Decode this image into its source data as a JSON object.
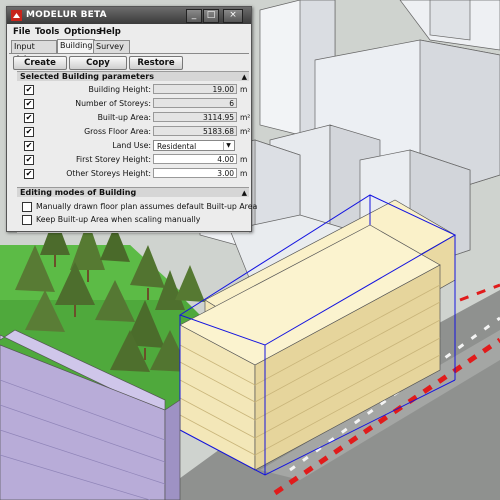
{
  "window": {
    "title": "MODELUR BETA",
    "controls": {
      "minimize": "_",
      "maximize": "□",
      "close": "×"
    }
  },
  "menu": [
    "File",
    "Tools",
    "Options",
    "Help"
  ],
  "tabs": [
    {
      "label": "Input data",
      "active": false
    },
    {
      "label": "Building",
      "active": true
    },
    {
      "label": "Survey",
      "active": false
    }
  ],
  "actions": {
    "create": "Create",
    "copy": "Copy",
    "restore": "Restore"
  },
  "sections": {
    "building_params": "Selected Building parameters",
    "editing_modes": "Editing modes of Building"
  },
  "params": {
    "building_height": {
      "label": "Building Height:",
      "value": "19.00",
      "unit": "m",
      "checked": true
    },
    "storeys": {
      "label": "Number of Storeys:",
      "value": "6",
      "unit": "",
      "checked": true
    },
    "builtup_area": {
      "label": "Built-up Area:",
      "value": "3114.95",
      "unit": "m²",
      "checked": true
    },
    "gross_floor_area": {
      "label": "Gross Floor Area:",
      "value": "5183.68",
      "unit": "m²",
      "checked": true
    },
    "land_use": {
      "label": "Land Use:",
      "value": "Residental",
      "unit": "",
      "checked": true
    },
    "first_storey_height": {
      "label": "First Storey Height:",
      "value": "4.00",
      "unit": "m",
      "checked": true
    },
    "other_storeys_height": {
      "label": "Other Storeys Height:",
      "value": "3.00",
      "unit": "m",
      "checked": true
    }
  },
  "options": [
    {
      "label": "Manually drawn floor plan assumes default Built-up Area",
      "checked": false
    },
    {
      "label": "Keep Built-up Area when scaling manually",
      "checked": false
    }
  ],
  "glyphs": {
    "check": "✔",
    "collapse": "▲",
    "dropdown": "▼"
  },
  "colors": {
    "selected_building": "#f3e7b8",
    "selection_outline": "#1414e0",
    "park": "#4fa93c",
    "neighbor_building": "#b8acd8",
    "context_building": "#eef0f4",
    "road_marking": "#e11b1b"
  }
}
